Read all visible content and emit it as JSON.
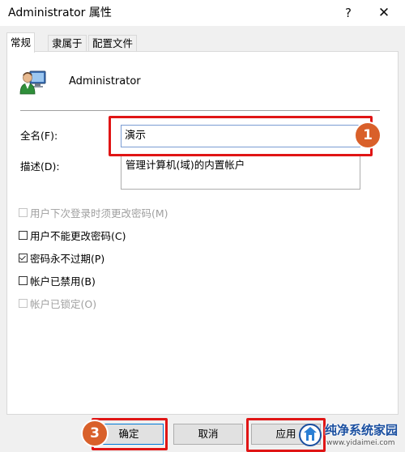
{
  "window": {
    "title": "Administrator 属性",
    "help_label": "?",
    "close_label": "✕"
  },
  "tabs": [
    {
      "label": "常规",
      "active": true
    },
    {
      "label": "隶属于",
      "active": false
    },
    {
      "label": "配置文件",
      "active": false
    }
  ],
  "user": {
    "icon": "user-account-icon",
    "name": "Administrator"
  },
  "fields": {
    "fullname_label": "全名(F):",
    "fullname_value": "演示",
    "description_label": "描述(D):",
    "description_value": "管理计算机(域)的内置帐户"
  },
  "checkboxes": [
    {
      "label": "用户下次登录时须更改密码(M)",
      "checked": false,
      "enabled": false
    },
    {
      "label": "用户不能更改密码(C)",
      "checked": false,
      "enabled": true
    },
    {
      "label": "密码永不过期(P)",
      "checked": true,
      "enabled": true
    },
    {
      "label": "帐户已禁用(B)",
      "checked": false,
      "enabled": true
    },
    {
      "label": "帐户已锁定(O)",
      "checked": false,
      "enabled": false
    }
  ],
  "buttons": {
    "ok": "确定",
    "cancel": "取消",
    "apply": "应用"
  },
  "annotations": [
    {
      "number": "1",
      "color": "#e01515"
    },
    {
      "number": "3",
      "color": "#e01515"
    }
  ],
  "watermark": {
    "name": "纯净系统家园",
    "url": "www.yidaimei.com"
  },
  "colors": {
    "annotation_red": "#e01515",
    "badge_orange": "#d9602a",
    "focus_blue": "#7a9cd3",
    "default_button_blue": "#0078d7"
  }
}
